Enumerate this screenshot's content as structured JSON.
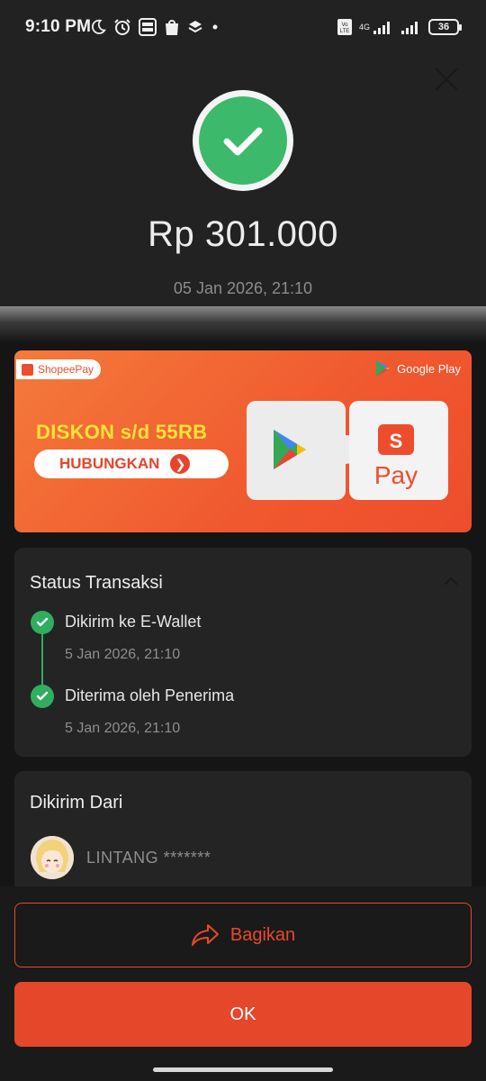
{
  "status_bar": {
    "time": "9:10 PM",
    "battery": "36",
    "network_label": "4G",
    "icons_left": [
      "moon-icon",
      "alarm-icon",
      "brimo-icon",
      "shopee-icon",
      "layers-icon",
      "dot-icon"
    ],
    "icons_right": [
      "volte-icon",
      "signal-icon",
      "signal-icon",
      "battery-icon"
    ]
  },
  "header": {
    "amount": "Rp 301.000",
    "datetime": "05 Jan 2026, 21:10"
  },
  "banner": {
    "shopeepay_label": "ShopeePay",
    "googleplay_label": "Google Play",
    "title": "DISKON s/d 55RB",
    "cta": "HUBUNGKAN",
    "pay_label": "Pay",
    "brand_color": "#ee4d2d"
  },
  "status_card": {
    "title": "Status Transaksi",
    "steps": [
      {
        "label": "Dikirim ke E-Wallet",
        "time": "5 Jan 2026, 21:10"
      },
      {
        "label": "Diterima oleh Penerima",
        "time": "5 Jan 2026, 21:10"
      }
    ],
    "accent": "#2fae5f"
  },
  "from_card": {
    "title": "Dikirim Dari",
    "sender": "LINTANG *******"
  },
  "actions": {
    "share": "Bagikan",
    "ok": "OK",
    "accent": "#e5472a"
  }
}
